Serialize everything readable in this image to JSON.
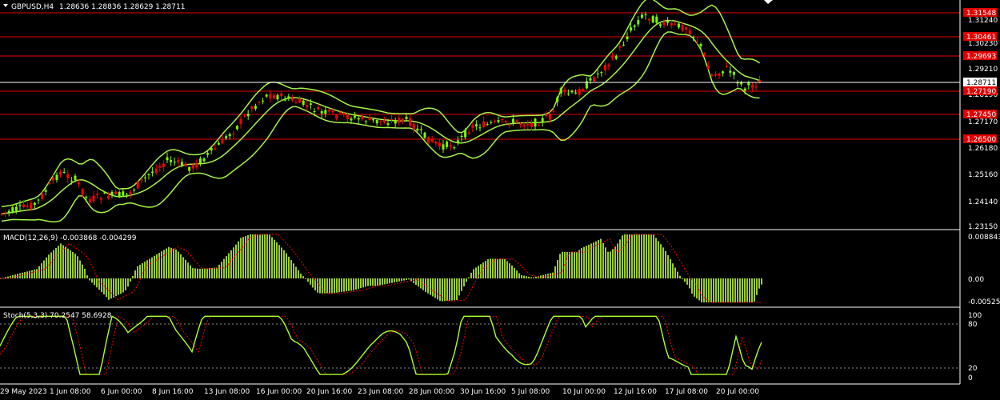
{
  "header": {
    "symbol": "GBPUSD,H4",
    "ohlc": "1.28636 1.28836 1.28629 1.28711"
  },
  "colors": {
    "background": "#000000",
    "bull": "#7CFC00",
    "bear": "#FF0000",
    "bands": "#A6F24A",
    "level": "#E00000",
    "macd_hist": "#9ACD32",
    "signal": "#FF0000",
    "stoch_main": "#ADFF2F",
    "stoch_signal": "#FF0000"
  },
  "price_axis": {
    "ticks": [
      "1.31240",
      "1.30230",
      "1.29210",
      "1.28190",
      "1.27170",
      "1.26180",
      "1.25160",
      "1.24140",
      "1.23150"
    ],
    "levels": [
      "1.31548",
      "1.30461",
      "1.29693",
      "1.27190",
      "1.27450",
      "1.26500"
    ],
    "current": "1.28711"
  },
  "macd": {
    "label": "MACD(12,26,9) -0.003868 -0.004299",
    "ticks": [
      "0.008843",
      "0.00",
      "-0.005253"
    ]
  },
  "stoch": {
    "label": "Stoch(5,3,3) 70.2547 58.6928",
    "ticks": [
      "100",
      "80",
      "20",
      "0"
    ]
  },
  "time_axis": {
    "labels": [
      "29 May 2023",
      "1 Jun 08:00",
      "6 Jun 00:00",
      "8 Jun 16:00",
      "13 Jun 08:00",
      "16 Jun 00:00",
      "20 Jun 16:00",
      "23 Jun 08:00",
      "28 Jun 00:00",
      "30 Jun 16:00",
      "5 Jul 08:00",
      "10 Jul 00:00",
      "12 Jul 16:00",
      "17 Jul 08:00",
      "20 Jul 00:00"
    ]
  }
}
